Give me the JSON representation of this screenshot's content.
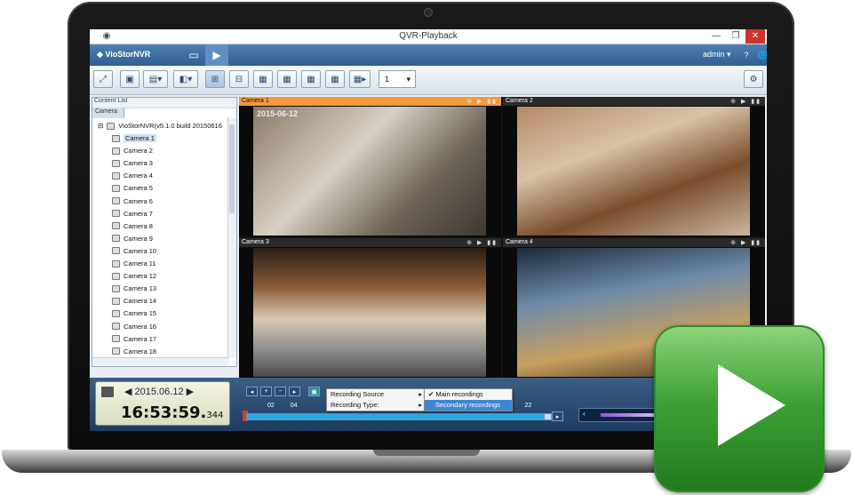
{
  "window": {
    "title": "QVR-Playback",
    "minimize": "—",
    "maximize": "❐",
    "close": "✕"
  },
  "topbar": {
    "logo": "VioStorNVR",
    "user": "admin",
    "user_caret": "▾",
    "help": "?",
    "globe": "🌐"
  },
  "toolbar": {
    "channel_select": "1",
    "select_caret": "▾"
  },
  "content_list": {
    "title": "Content List",
    "tab": "Camera",
    "root": "VioStorNVR(v5.1.0 build 20150616",
    "cameras": [
      "Camera 1",
      "Camera 2",
      "Camera 3",
      "Camera 4",
      "Camera 5",
      "Camera 6",
      "Camera 7",
      "Camera 8",
      "Camera 9",
      "Camera 10",
      "Camera 11",
      "Camera 12",
      "Camera 13",
      "Camera 14",
      "Camera 15",
      "Camera 16",
      "Camera 17",
      "Camera 18"
    ],
    "selected": "Camera 1"
  },
  "tiles": [
    {
      "label": "Camera 1",
      "active": true,
      "timestamp": "2015-06-12"
    },
    {
      "label": "Camera 2",
      "active": false
    },
    {
      "label": "Camera 3",
      "active": false
    },
    {
      "label": "Camera 4",
      "active": false
    }
  ],
  "clock": {
    "date": "2015.06.12",
    "time": "16:53:59.",
    "ms": "344",
    "prev": "◀",
    "next": "▶"
  },
  "timeline": {
    "ticks": [
      "02",
      "04",
      "22"
    ],
    "progress": 0.98
  },
  "menu": {
    "items": [
      "Recording Source",
      "Recording Type:"
    ],
    "submenu": [
      "Main recordings",
      "Secondary recordings"
    ],
    "checked": "✔",
    "arrow": "▸"
  },
  "colors": {
    "accent": "#2f5f93",
    "active_tile": "#f29a3a",
    "app_icon": "#3ea236"
  }
}
